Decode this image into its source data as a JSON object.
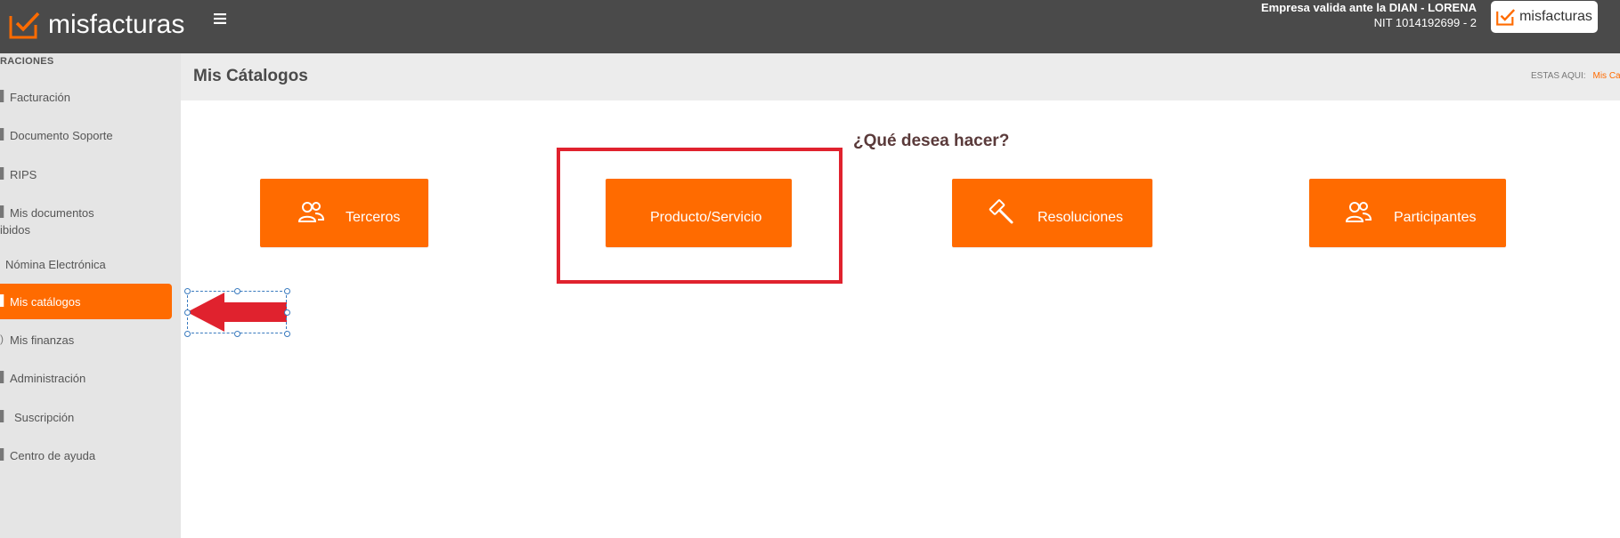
{
  "header": {
    "brand": "misfacturas",
    "company_name": "Empresa valida ante la DIAN - LORENA",
    "nit": "NIT 1014192699 - 2",
    "logo_text": "misfacturas"
  },
  "sidebar": {
    "heading": "RACIONES",
    "items": [
      {
        "label": "Facturación"
      },
      {
        "label": "Documento Soporte"
      },
      {
        "label": "RIPS"
      },
      {
        "label": "Mis documentos"
      },
      {
        "label": "ibidos"
      },
      {
        "label": "Nómina Electrónica"
      },
      {
        "label": "Mis catálogos"
      },
      {
        "label": "Mis finanzas"
      },
      {
        "label": "Administración"
      },
      {
        "label": "Suscripción"
      },
      {
        "label": "Centro de ayuda"
      }
    ]
  },
  "page": {
    "title": "Mis Cátalogos",
    "breadcrumb_label": "ESTAS AQUI:",
    "breadcrumb_current": "Mis Ca"
  },
  "main": {
    "question": "¿Qué desea hacer?",
    "buttons": [
      {
        "label": "Terceros",
        "icon": "users-icon"
      },
      {
        "label": "Producto/Servicio",
        "icon": ""
      },
      {
        "label": "Resoluciones",
        "icon": "gavel-icon"
      },
      {
        "label": "Participantes",
        "icon": "users-icon"
      }
    ]
  },
  "colors": {
    "accent": "#ff6b00",
    "topbar": "#4a4a4a",
    "highlight": "#e0222e"
  }
}
